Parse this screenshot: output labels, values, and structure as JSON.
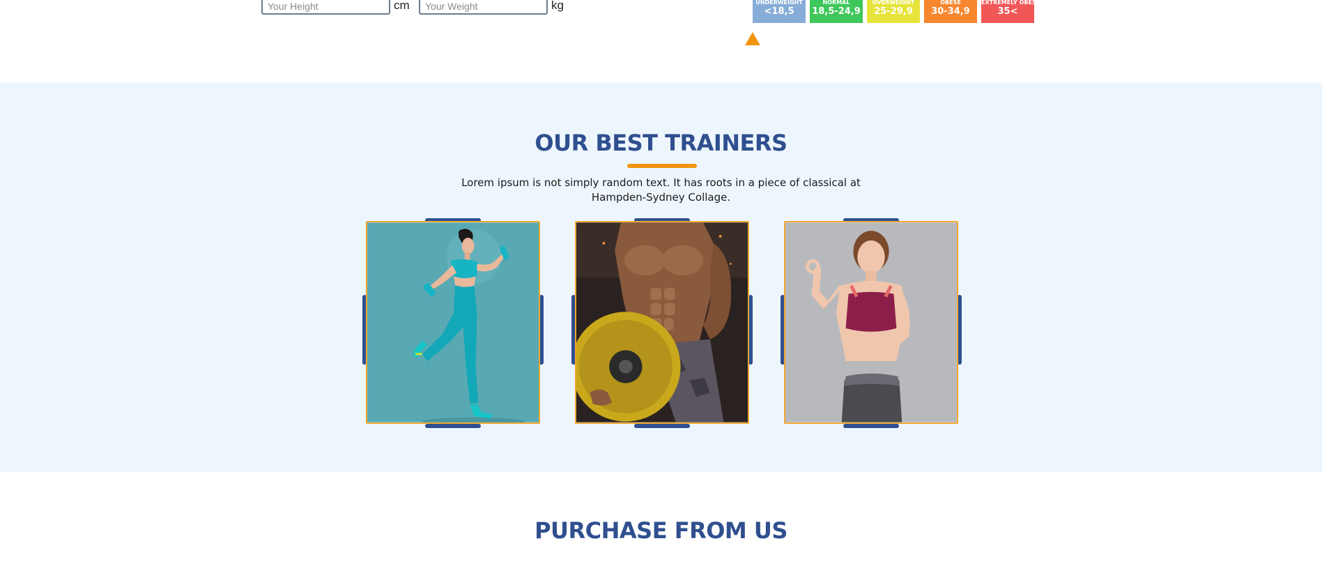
{
  "bmi": {
    "height_placeholder": "Your Height",
    "height_unit": "cm",
    "weight_placeholder": "Your Weight",
    "weight_unit": "kg",
    "categories": [
      {
        "label": "UNDERWEIGHT",
        "range": "<18,5",
        "color": "#86acd8"
      },
      {
        "label": "NORMAL",
        "range": "18,5-24,9",
        "color": "#3ec75a"
      },
      {
        "label": "OVERWEIGHT",
        "range": "25-29,9",
        "color": "#e6e43a"
      },
      {
        "label": "OBESE",
        "range": "30-34,9",
        "color": "#f7862e"
      },
      {
        "label": "EXTREMELY OBESE",
        "range": "35<",
        "color": "#f25757"
      }
    ],
    "marker_color": "#f0960e"
  },
  "trainers": {
    "title": "OUR BEST TRAINERS",
    "description": "Lorem ipsum is not simply random text. It has roots in a piece of classical at Hampden-Sydney Collage.",
    "accent_color": "#f0960e",
    "brand_color": "#2f4f8f",
    "cards": [
      {
        "photo": "female-runner-with-dumbbells"
      },
      {
        "photo": "muscular-man-with-weight-plate"
      },
      {
        "photo": "smiling-woman-ok-gesture"
      }
    ]
  },
  "purchase": {
    "title": "PURCHASE FROM US"
  }
}
